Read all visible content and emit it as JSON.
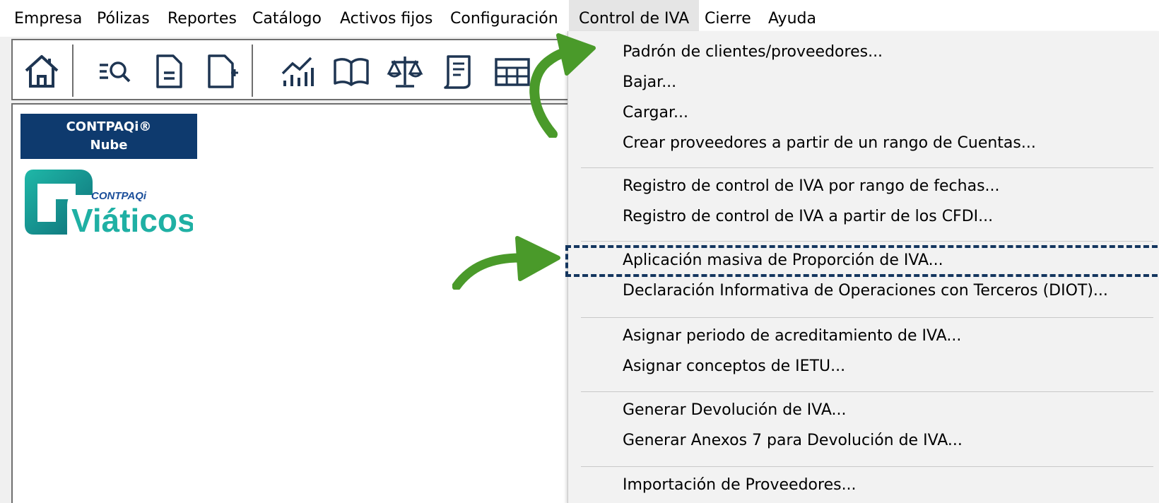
{
  "menubar": {
    "items": [
      "Empresa",
      "Pólizas",
      "Reportes",
      "Catálogo",
      "Activos fijos",
      "Configuración",
      "Control de IVA",
      "Cierre",
      "Ayuda"
    ],
    "active": "Control de IVA"
  },
  "toolbar": {
    "icons": [
      "home-icon",
      "search-list-icon",
      "document-icon",
      "new-document-icon",
      "chart-icon",
      "book-icon",
      "balance-scale-icon",
      "notepad-icon",
      "table-icon"
    ]
  },
  "panel": {
    "badge_line1": "CONTPAQi®",
    "badge_line2": "Nube",
    "logo_brand": "CONTPAQi",
    "logo_product": "Viáticos"
  },
  "dropdown": {
    "items": [
      "Padrón de clientes/proveedores...",
      "Bajar...",
      "Cargar...",
      "Crear proveedores a partir de un rango de Cuentas...",
      "Registro de control de IVA por rango de fechas...",
      "Registro de control de IVA a partir de los CFDI...",
      "Aplicación masiva de Proporción de IVA...",
      "Declaración Informativa de Operaciones con Terceros (DIOT)...",
      "Asignar periodo de acreditamiento de IVA...",
      "Asignar conceptos de IETU...",
      "Generar Devolución de IVA...",
      "Generar Anexos 7 para Devolución de IVA...",
      "Importación de Proveedores..."
    ],
    "highlighted": "Aplicación masiva de Proporción de IVA..."
  },
  "colors": {
    "annotation_arrow": "#4a9a2a",
    "highlight_border": "#14365f",
    "badge_bg": "#0e3a6e",
    "logo_teal": "#1fb8a8"
  }
}
